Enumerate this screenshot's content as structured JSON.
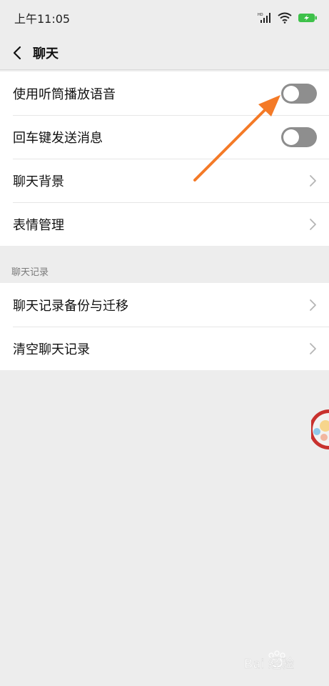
{
  "status": {
    "time": "上午11:05",
    "hd_label": "HD"
  },
  "header": {
    "title": "聊天"
  },
  "settings": {
    "voice_earpiece": "使用听筒播放语音",
    "enter_send": "回车键发送消息",
    "chat_background": "聊天背景",
    "sticker_manage": "表情管理"
  },
  "history": {
    "section_title": "聊天记录",
    "backup_migrate": "聊天记录备份与迁移",
    "clear_history": "清空聊天记录"
  },
  "watermark": {
    "text": "Bai  经验"
  },
  "colors": {
    "toggle_off": "#8e8e8e",
    "arrow": "#f47a27",
    "battery": "#3ec14a"
  }
}
